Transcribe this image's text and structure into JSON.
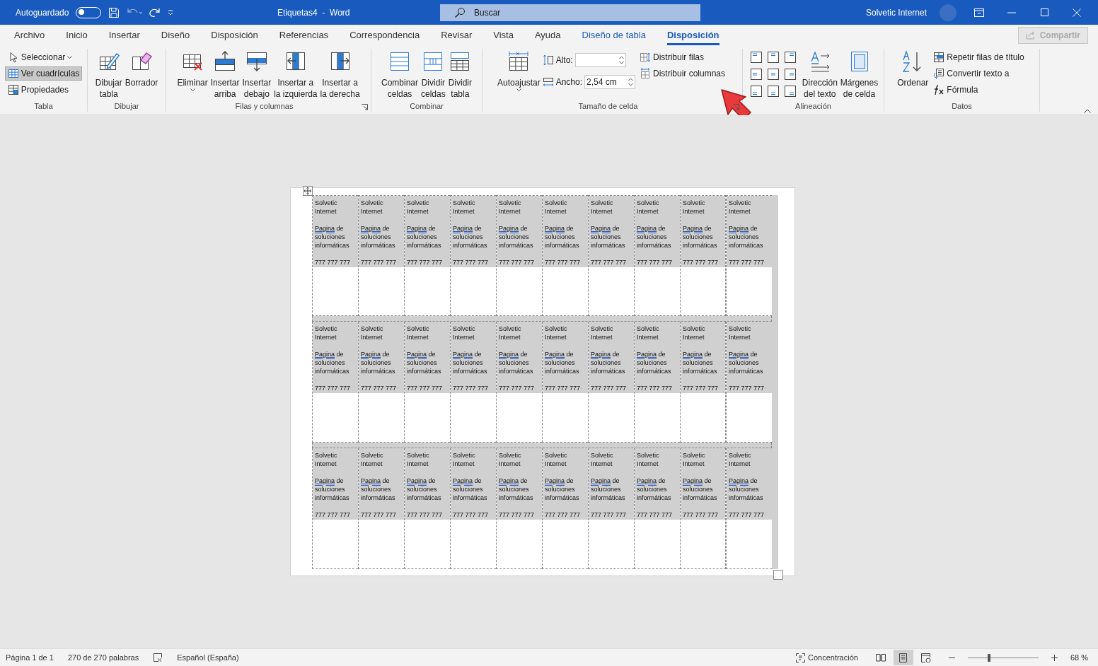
{
  "title_bar": {
    "autosave_label": "Autoguardado",
    "autosave_on": false,
    "document_title": "Etiquetas4  -  Word",
    "search_placeholder": "Buscar",
    "user_name": "Solvetic Internet"
  },
  "tabs": [
    {
      "label": "Archivo",
      "kind": "plain",
      "selected": false
    },
    {
      "label": "Inicio",
      "kind": "plain",
      "selected": false
    },
    {
      "label": "Insertar",
      "kind": "plain",
      "selected": false
    },
    {
      "label": "Diseño",
      "kind": "plain",
      "selected": false
    },
    {
      "label": "Disposición",
      "kind": "plain",
      "selected": false
    },
    {
      "label": "Referencias",
      "kind": "plain",
      "selected": false
    },
    {
      "label": "Correspondencia",
      "kind": "plain",
      "selected": false
    },
    {
      "label": "Revisar",
      "kind": "plain",
      "selected": false
    },
    {
      "label": "Vista",
      "kind": "plain",
      "selected": false
    },
    {
      "label": "Ayuda",
      "kind": "plain",
      "selected": false
    },
    {
      "label": "Diseño de tabla",
      "kind": "contextual",
      "selected": false
    },
    {
      "label": "Disposición",
      "kind": "contextual",
      "selected": true
    }
  ],
  "share_button": {
    "label": "Compartir",
    "disabled": true
  },
  "ribbon_groups": [
    {
      "label": "Tabla",
      "launcher": false,
      "items": [
        {
          "kind": "small",
          "label": "Seleccionar",
          "dropdown": true,
          "on": false
        },
        {
          "kind": "small",
          "label": "Ver cuadrículas",
          "dropdown": false,
          "on": true
        },
        {
          "kind": "small",
          "label": "Propiedades",
          "dropdown": false,
          "on": false
        }
      ]
    },
    {
      "label": "Dibujar",
      "launcher": false,
      "items": [
        {
          "kind": "large",
          "lines": [
            "Dibujar",
            "tabla"
          ],
          "dropdown": false
        },
        {
          "kind": "large",
          "lines": [
            "Borrador"
          ],
          "dropdown": false
        }
      ]
    },
    {
      "label": "Filas y columnas",
      "launcher": true,
      "items": [
        {
          "kind": "large",
          "lines": [
            "Eliminar"
          ],
          "dropdown": true
        },
        {
          "kind": "large",
          "lines": [
            "Insertar",
            "arriba"
          ],
          "dropdown": false
        },
        {
          "kind": "large",
          "lines": [
            "Insertar",
            "debajo"
          ],
          "dropdown": false
        },
        {
          "kind": "large",
          "lines": [
            "Insertar a",
            "la izquierda"
          ],
          "dropdown": false
        },
        {
          "kind": "large",
          "lines": [
            "Insertar a",
            "la derecha"
          ],
          "dropdown": false
        }
      ]
    },
    {
      "label": "Combinar",
      "launcher": false,
      "items": [
        {
          "kind": "large",
          "lines": [
            "Combinar",
            "celdas"
          ],
          "dropdown": false
        },
        {
          "kind": "large",
          "lines": [
            "Dividir",
            "celdas"
          ],
          "dropdown": false
        },
        {
          "kind": "large",
          "lines": [
            "Dividir",
            "tabla"
          ],
          "dropdown": false
        }
      ]
    },
    {
      "label": "Tamaño de celda",
      "launcher": true,
      "items": [
        {
          "kind": "large",
          "lines": [
            "Autoajustar"
          ],
          "dropdown": true
        },
        {
          "kind": "field",
          "label": "Alto:"
        },
        {
          "kind": "field",
          "label": "Ancho:",
          "value": "2,54 cm"
        },
        {
          "kind": "small",
          "label": "Distribuir filas",
          "dropdown": false
        },
        {
          "kind": "small",
          "label": "Distribuir columnas",
          "dropdown": false
        }
      ]
    },
    {
      "label": "Alineación",
      "launcher": false,
      "items": [
        {
          "kind": "align-grid"
        },
        {
          "kind": "large",
          "lines": [
            "Dirección",
            "del texto"
          ],
          "dropdown": false
        },
        {
          "kind": "large",
          "lines": [
            "Márgenes",
            "de celda"
          ],
          "dropdown": false
        }
      ]
    },
    {
      "label": "Datos",
      "launcher": false,
      "items": [
        {
          "kind": "large",
          "lines": [
            "Ordenar"
          ],
          "dropdown": false
        },
        {
          "kind": "small",
          "label": "Repetir filas de título",
          "dropdown": false
        },
        {
          "kind": "small",
          "label": "Convertir texto a",
          "dropdown": false
        },
        {
          "kind": "small",
          "label": "Fórmula",
          "dropdown": false
        }
      ]
    }
  ],
  "label_rows": [
    {
      "cells": [
        {
          "name": "Solvetic Internet",
          "flagged_word": "Pagina",
          "description": "de soluciones informáticas",
          "phone": "777 777 777"
        },
        {
          "name": "Solvetic Internet",
          "flagged_word": "Pagina",
          "description": "de soluciones informáticas",
          "phone": "777 777 777"
        },
        {
          "name": "Solvetic Internet",
          "flagged_word": "Pagina",
          "description": "de soluciones informáticas",
          "phone": "777 777 777"
        },
        {
          "name": "Solvetic Internet",
          "flagged_word": "Pagina",
          "description": "de soluciones informáticas",
          "phone": "777 777 777"
        },
        {
          "name": "Solvetic Internet",
          "flagged_word": "Pagina",
          "description": "de soluciones informáticas",
          "phone": "777 777 777"
        },
        {
          "name": "Solvetic Internet",
          "flagged_word": "Pagina",
          "description": "de soluciones informáticas",
          "phone": "777 777 777"
        },
        {
          "name": "Solvetic Internet",
          "flagged_word": "Pagina",
          "description": "de soluciones informáticas",
          "phone": "777 777 777"
        },
        {
          "name": "Solvetic Internet",
          "flagged_word": "Pagina",
          "description": "de soluciones informáticas",
          "phone": "777 777 777"
        },
        {
          "name": "Solvetic Internet",
          "flagged_word": "Pagina",
          "description": "de soluciones informáticas",
          "phone": "777 777 777"
        },
        {
          "name": "Solvetic Internet",
          "flagged_word": "Pagina",
          "description": "de soluciones informáticas",
          "phone": "777 777 777"
        }
      ]
    },
    {
      "cells": [
        {
          "name": "Solvetic Internet",
          "flagged_word": "Pagina",
          "description": "de soluciones informáticas",
          "phone": "777 777 777"
        },
        {
          "name": "Solvetic Internet",
          "flagged_word": "Pagina",
          "description": "de soluciones informáticas",
          "phone": "777 777 777"
        },
        {
          "name": "Solvetic Internet",
          "flagged_word": "Pagina",
          "description": "de soluciones informáticas",
          "phone": "777 777 777"
        },
        {
          "name": "Solvetic Internet",
          "flagged_word": "Pagina",
          "description": "de soluciones informáticas",
          "phone": "777 777 777"
        },
        {
          "name": "Solvetic Internet",
          "flagged_word": "Pagina",
          "description": "de soluciones informáticas",
          "phone": "777 777 777"
        },
        {
          "name": "Solvetic Internet",
          "flagged_word": "Pagina",
          "description": "de soluciones informáticas",
          "phone": "777 777 777"
        },
        {
          "name": "Solvetic Internet",
          "flagged_word": "Pagina",
          "description": "de soluciones informáticas",
          "phone": "777 777 777"
        },
        {
          "name": "Solvetic Internet",
          "flagged_word": "Pagina",
          "description": "de soluciones informáticas",
          "phone": "777 777 777"
        },
        {
          "name": "Solvetic Internet",
          "flagged_word": "Pagina",
          "description": "de soluciones informáticas",
          "phone": "777 777 777"
        },
        {
          "name": "Solvetic Internet",
          "flagged_word": "Pagina",
          "description": "de soluciones informáticas",
          "phone": "777 777 777"
        }
      ]
    },
    {
      "cells": [
        {
          "name": "Solvetic Internet",
          "flagged_word": "Pagina",
          "description": "de soluciones informáticas",
          "phone": "777 777 777"
        },
        {
          "name": "Solvetic Internet",
          "flagged_word": "Pagina",
          "description": "de soluciones informáticas",
          "phone": "777 777 777"
        },
        {
          "name": "Solvetic Internet",
          "flagged_word": "Pagina",
          "description": "de soluciones informáticas",
          "phone": "777 777 777"
        },
        {
          "name": "Solvetic Internet",
          "flagged_word": "Pagina",
          "description": "de soluciones informáticas",
          "phone": "777 777 777"
        },
        {
          "name": "Solvetic Internet",
          "flagged_word": "Pagina",
          "description": "de soluciones informáticas",
          "phone": "777 777 777"
        },
        {
          "name": "Solvetic Internet",
          "flagged_word": "Pagina",
          "description": "de soluciones informáticas",
          "phone": "777 777 777"
        },
        {
          "name": "Solvetic Internet",
          "flagged_word": "Pagina",
          "description": "de soluciones informáticas",
          "phone": "777 777 777"
        },
        {
          "name": "Solvetic Internet",
          "flagged_word": "Pagina",
          "description": "de soluciones informáticas",
          "phone": "777 777 777"
        },
        {
          "name": "Solvetic Internet",
          "flagged_word": "Pagina",
          "description": "de soluciones informáticas",
          "phone": "777 777 777"
        },
        {
          "name": "Solvetic Internet",
          "flagged_word": "Pagina",
          "description": "de soluciones informáticas",
          "phone": "777 777 777"
        }
      ]
    }
  ],
  "status_bar": {
    "page": "Página 1 de 1",
    "words": "270 de 270 palabras",
    "language": "Español (España)",
    "focus_label": "Concentración",
    "views": [
      {
        "kind": "read",
        "selected": false
      },
      {
        "kind": "print",
        "selected": true
      },
      {
        "kind": "web",
        "selected": false
      }
    ],
    "zoom": {
      "level": 0.3,
      "reading": "68 %"
    }
  }
}
